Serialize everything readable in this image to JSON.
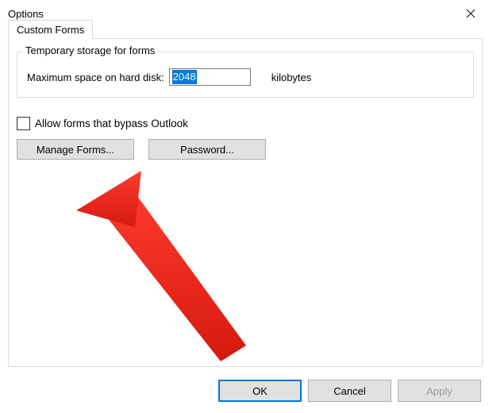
{
  "window": {
    "title": "Options"
  },
  "tabs": {
    "custom_forms": "Custom Forms"
  },
  "group": {
    "legend": "Temporary storage for forms",
    "max_space_label": "Maximum space on hard disk:",
    "max_space_value": "2048",
    "unit_label": "kilobytes"
  },
  "checkbox": {
    "allow_bypass_label": "Allow forms that bypass Outlook",
    "checked": false
  },
  "buttons": {
    "manage_forms": "Manage Forms...",
    "password": "Password..."
  },
  "footer": {
    "ok": "OK",
    "cancel": "Cancel",
    "apply": "Apply"
  }
}
